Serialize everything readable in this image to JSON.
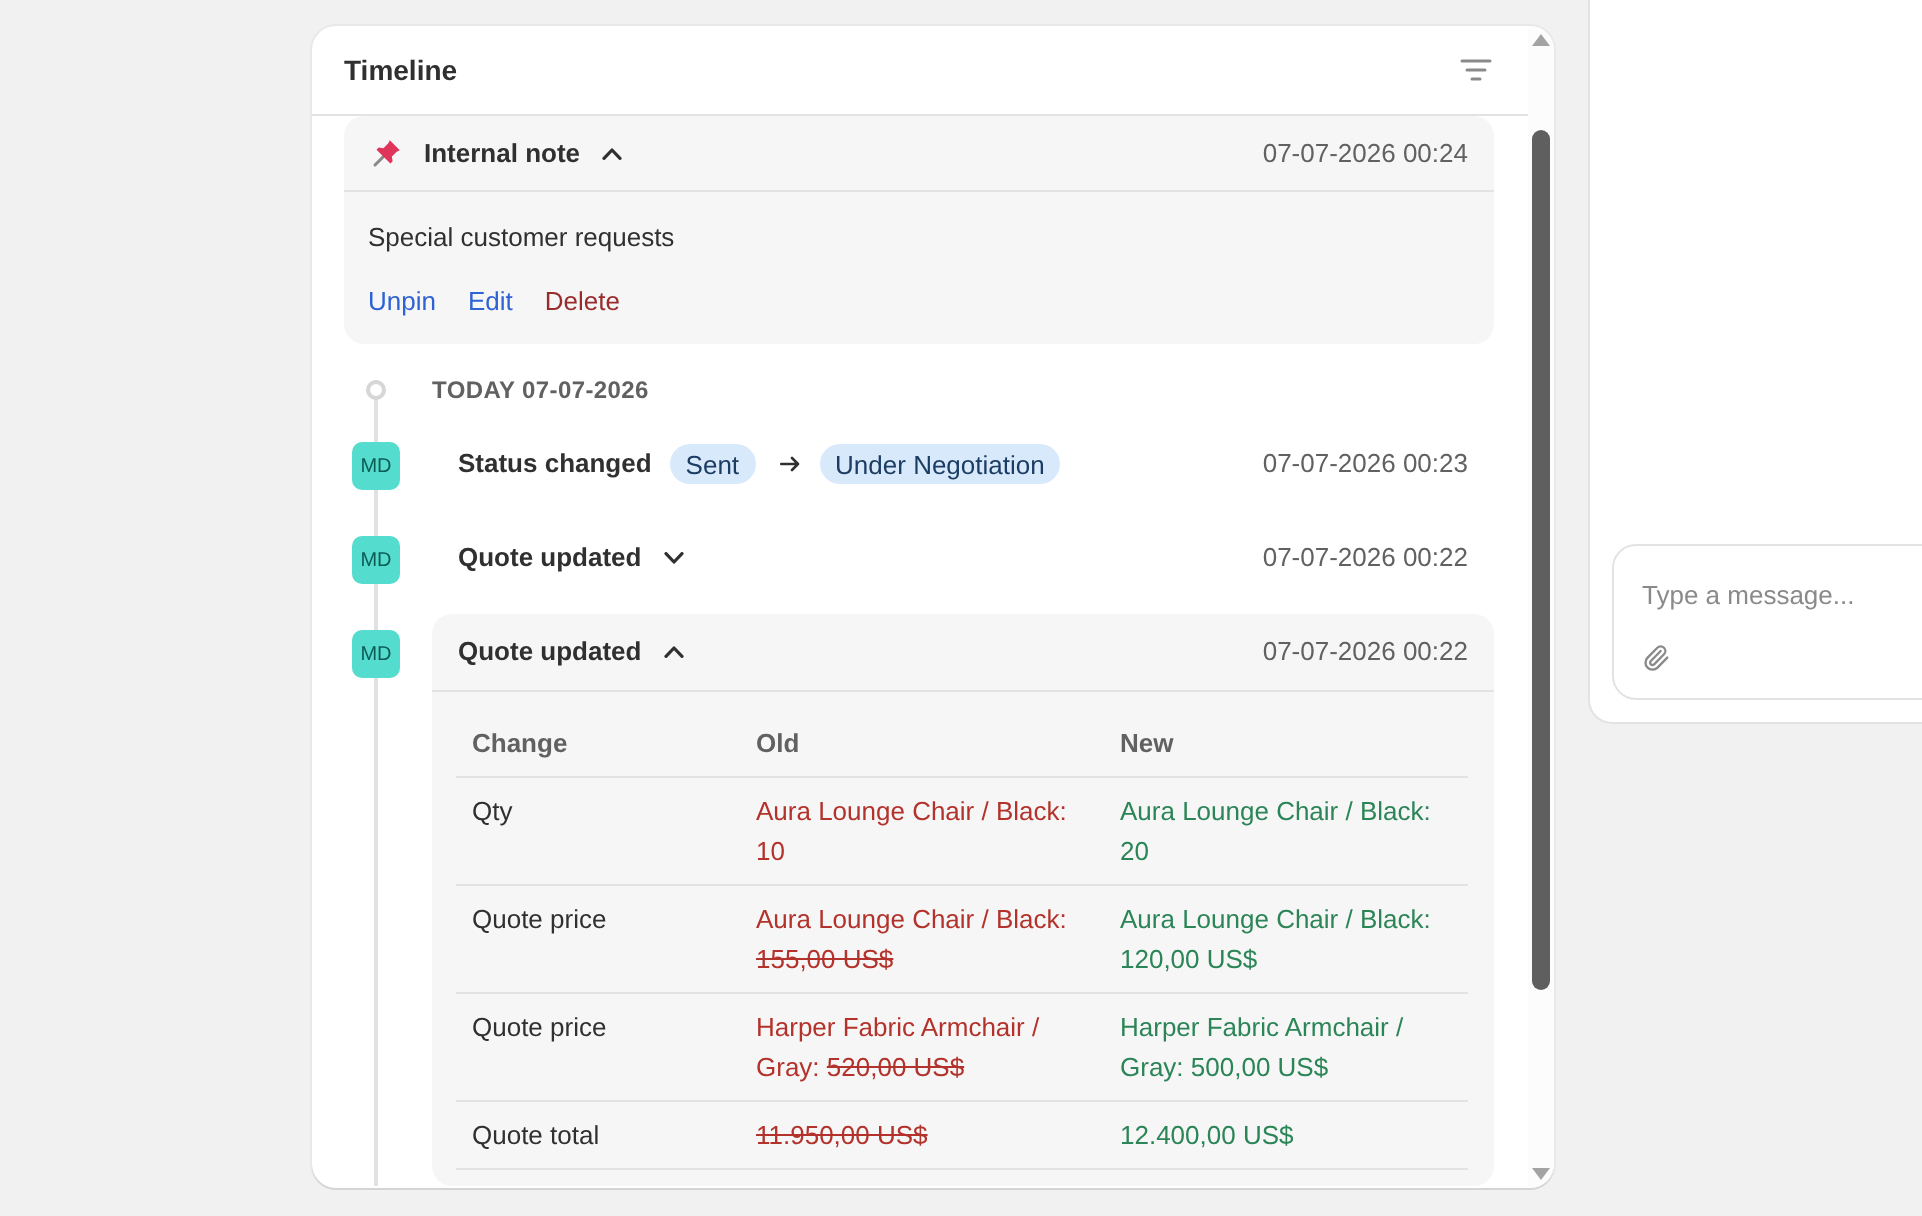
{
  "timeline": {
    "title": "Timeline",
    "pinned_note": {
      "label": "Internal note",
      "expanded": true,
      "time": "07-07-2026 00:24",
      "body": "Special customer requests",
      "actions": [
        {
          "label": "Unpin",
          "kind": "link"
        },
        {
          "label": "Edit",
          "kind": "link"
        },
        {
          "label": "Delete",
          "kind": "danger"
        }
      ]
    },
    "date_heading": "TODAY 07-07-2026",
    "events": [
      {
        "kind": "status",
        "avatar": "MD",
        "title": "Status changed",
        "from": "Sent",
        "to": "Under Negotiation",
        "time": "07-07-2026 00:23"
      },
      {
        "kind": "change",
        "avatar": "MD",
        "title": "Quote updated",
        "expanded": false,
        "time": "07-07-2026 00:22"
      },
      {
        "kind": "change",
        "avatar": "MD",
        "title": "Quote updated",
        "expanded": true,
        "time": "07-07-2026 00:22",
        "table": {
          "columns": [
            "Change",
            "Old",
            "New"
          ],
          "rows": [
            {
              "change": "Qty",
              "old": {
                "text": "Aura Lounge Chair / Black:",
                "amount": "10",
                "struck": false
              },
              "new": {
                "text": "Aura Lounge Chair / Black:",
                "amount": "20"
              }
            },
            {
              "change": "Quote price",
              "old": {
                "text": "Aura Lounge Chair / Black:",
                "amount": "155,00 US$",
                "struck": true
              },
              "new": {
                "text": "Aura Lounge Chair / Black:",
                "amount": "120,00 US$"
              }
            },
            {
              "change": "Quote price",
              "old": {
                "text": "Harper Fabric Armchair / Gray:",
                "amount": "520,00 US$",
                "struck": true
              },
              "new": {
                "text": "Harper Fabric Armchair / Gray:",
                "amount": "500,00 US$"
              }
            },
            {
              "change": "Quote total",
              "old": {
                "amount": "11.950,00 US$",
                "struck": true
              },
              "new": {
                "amount": "12.400,00 US$"
              }
            }
          ]
        }
      }
    ]
  },
  "chat": {
    "placeholder": "Type a message..."
  }
}
